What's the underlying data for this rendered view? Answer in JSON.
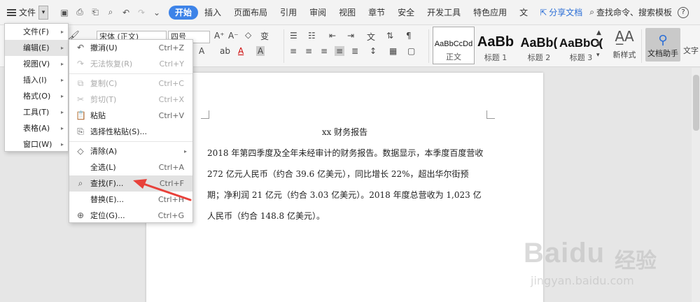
{
  "titlebar": {
    "file_label": "文件",
    "tabs": [
      "开始",
      "插入",
      "页面布局",
      "引用",
      "审阅",
      "视图",
      "章节",
      "安全",
      "开发工具",
      "特色应用",
      "文"
    ],
    "share_label": "分享文档",
    "search_label": "查找命令、搜索模板",
    "help_label": "?"
  },
  "ribbon": {
    "font_name": "宋体 (正文)",
    "font_size": "四号",
    "styles": [
      {
        "sample": "AaBbCcDd",
        "name": "正文"
      },
      {
        "sample": "AaBb",
        "name": "标题 1"
      },
      {
        "sample": "AaBb(",
        "name": "标题 2"
      },
      {
        "sample": "AaBbC(",
        "name": "标题 3"
      }
    ],
    "new_style": "新样式",
    "doc_assistant": "文档助手",
    "text_tool": "文字"
  },
  "menu_main": [
    {
      "label": "文件(F)",
      "selected": false
    },
    {
      "label": "编辑(E)",
      "selected": true
    },
    {
      "label": "视图(V)",
      "selected": false
    },
    {
      "label": "插入(I)",
      "selected": false
    },
    {
      "label": "格式(O)",
      "selected": false
    },
    {
      "label": "工具(T)",
      "selected": false
    },
    {
      "label": "表格(A)",
      "selected": false
    },
    {
      "label": "窗口(W)",
      "selected": false
    }
  ],
  "menu_edit": [
    {
      "label": "撤消(U)",
      "shortcut": "Ctrl+Z",
      "disabled": false,
      "icon": "undo-icon"
    },
    {
      "label": "无法恢复(R)",
      "shortcut": "Ctrl+Y",
      "disabled": true,
      "icon": "redo-icon"
    },
    {
      "label": "复制(C)",
      "shortcut": "Ctrl+C",
      "disabled": true,
      "icon": "copy-icon"
    },
    {
      "label": "剪切(T)",
      "shortcut": "Ctrl+X",
      "disabled": true,
      "icon": "cut-icon"
    },
    {
      "label": "粘贴",
      "shortcut": "Ctrl+V",
      "disabled": false,
      "icon": "paste-icon"
    },
    {
      "label": "选择性粘贴(S)...",
      "shortcut": "",
      "disabled": false,
      "icon": "paste-special-icon"
    },
    {
      "label": "清除(A)",
      "shortcut": "",
      "disabled": false,
      "icon": "eraser-icon"
    },
    {
      "label": "全选(L)",
      "shortcut": "Ctrl+A",
      "disabled": false,
      "icon": ""
    },
    {
      "label": "查找(F)...",
      "shortcut": "Ctrl+F",
      "disabled": false,
      "icon": "search-icon"
    },
    {
      "label": "替换(E)...",
      "shortcut": "Ctrl+H",
      "disabled": false,
      "icon": ""
    },
    {
      "label": "定位(G)...",
      "shortcut": "Ctrl+G",
      "disabled": false,
      "icon": "goto-icon"
    }
  ],
  "document": {
    "title": "xx 财务报告",
    "body": "2018 年第四季度及全年未经审计的财务报告。数据显示，本季度百度营收 272 亿元人民币（约合 39.6 亿美元），同比增长 22%，超出华尔街预期；净利润 21 亿元（约合 3.03 亿美元）。2018 年度总营收为 1,023 亿人民币（约合 148.8 亿美元）。"
  },
  "watermark": {
    "brand": "Baidu",
    "brand_cn": "经验",
    "url": "jingyan.baidu.com"
  },
  "colors": {
    "accent": "#3d83e8",
    "arrow": "#e8413a"
  }
}
